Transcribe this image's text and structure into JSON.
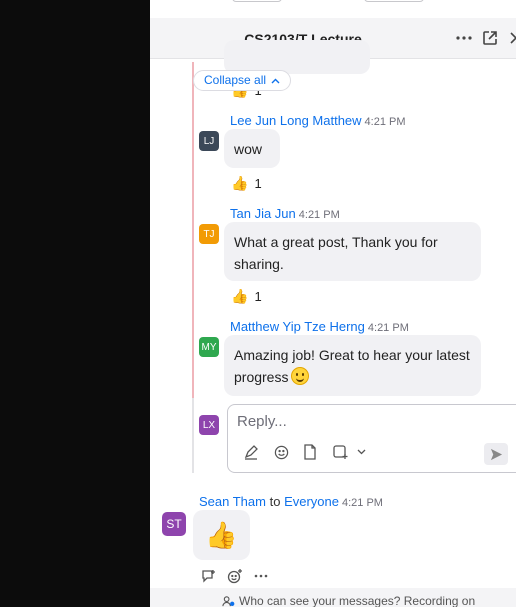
{
  "header": {
    "title": "CS2103/T Lecture"
  },
  "thread": {
    "collapse_label": "Collapse all",
    "first_reaction_count": "1",
    "messages": [
      {
        "initials": "LJ",
        "color": "#3b4858",
        "name": "Lee Jun Long Matthew",
        "time": "4:21 PM",
        "text": "wow",
        "reaction_count": "1"
      },
      {
        "initials": "TJ",
        "color": "#f29b05",
        "name": "Tan Jia Jun",
        "time": "4:21 PM",
        "text": "What a great post, Thank you for sharing.",
        "reaction_count": "1"
      },
      {
        "initials": "MY",
        "color": "#2fa84f",
        "name": "Matthew Yip Tze Herng",
        "time": "4:21 PM",
        "text": "Amazing job! Great to hear your latest progress"
      }
    ],
    "reply": {
      "initials": "LX",
      "color": "#8e44ad",
      "placeholder": "Reply..."
    }
  },
  "main_message": {
    "initials": "ST",
    "color": "#8e44ad",
    "sender": "Sean Tham",
    "to_label": "to",
    "recipient": "Everyone",
    "time": "4:21 PM"
  },
  "footer": {
    "text": "Who can see your messages? Recording on"
  },
  "icons": [
    "more-icon",
    "pop-out-icon",
    "close-icon",
    "chevron-up-icon",
    "thumbs-up-icon",
    "smiley-emoji-icon",
    "format-icon",
    "emoji-icon",
    "file-icon",
    "screenshot-icon",
    "chevron-down-icon",
    "send-icon",
    "reply-thread-icon",
    "add-reaction-icon",
    "more-actions-icon",
    "people-icon"
  ]
}
